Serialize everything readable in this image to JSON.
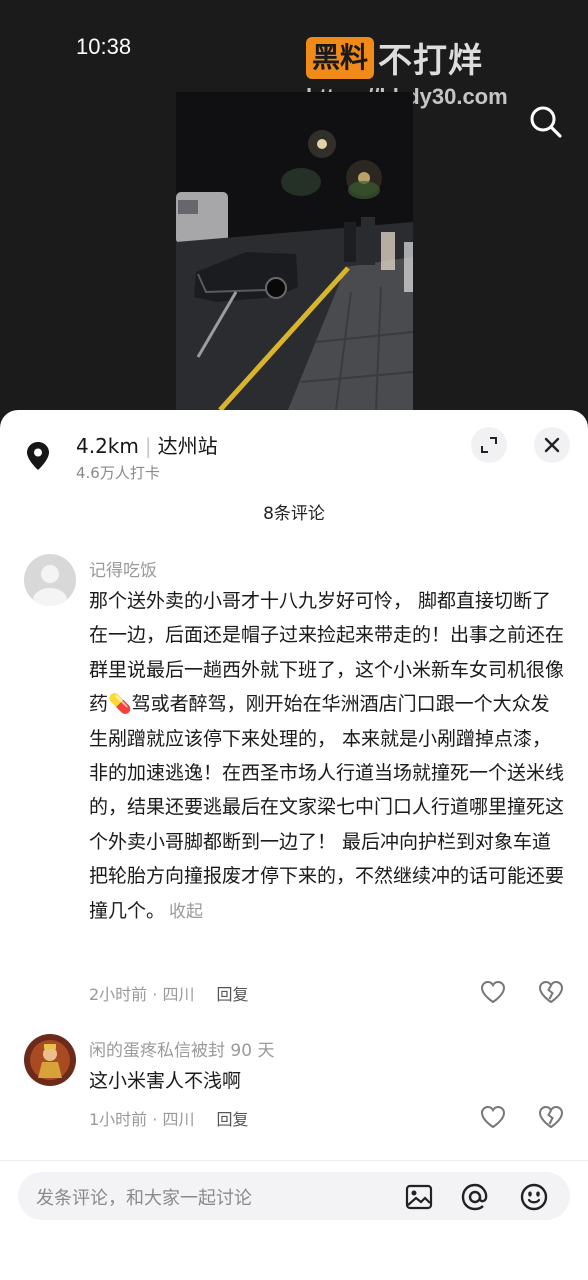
{
  "status_bar": {
    "time": "10:38"
  },
  "watermark": {
    "badge": "黑料",
    "text": "不打烊",
    "url": "https://bbdy30.com"
  },
  "location": {
    "distance": "4.2km",
    "name": "达州站",
    "checkins": "4.6万人打卡"
  },
  "comments_header": {
    "count_label": "8条评论"
  },
  "comments": [
    {
      "username": "记得吃饭",
      "text": "那个送外卖的小哥才十八九岁好可怜， 脚都直接切断了在一边，后面还是帽子过来捡起来带走的！出事之前还在群里说最后一趟西外就下班了，这个小米新车女司机很像药💊驾或者醉驾，刚开始在华洲酒店门口跟一个大众发生剐蹭就应该停下来处理的， 本来就是小剐蹭掉点漆，非的加速逃逸！在西圣市场人行道当场就撞死一个送米线的，结果还要逃最后在文家梁七中门口人行道哪里撞死这个外卖小哥脚都断到一边了！ 最后冲向护栏到对象车道把轮胎方向撞报废才停下来的，不然继续冲的话可能还要撞几个。",
      "collapse": "收起",
      "time_location": "2小时前 · 四川",
      "reply": "回复"
    },
    {
      "username": "闲的蛋疼私信被封 90 天",
      "text": "这小米害人不浅啊",
      "time_location": "1小时前 · 四川",
      "reply": "回复"
    }
  ],
  "input": {
    "placeholder": "发条评论，和大家一起讨论"
  },
  "icons": [
    "search-icon",
    "location-pin-icon",
    "expand-icon",
    "close-icon",
    "heart-icon",
    "broken-heart-icon",
    "image-icon",
    "at-icon",
    "emoji-icon"
  ],
  "colors": {
    "watermark_orange": "#f08a18",
    "sheet_bg": "#ffffff",
    "backdrop": "#1b1b1b"
  }
}
